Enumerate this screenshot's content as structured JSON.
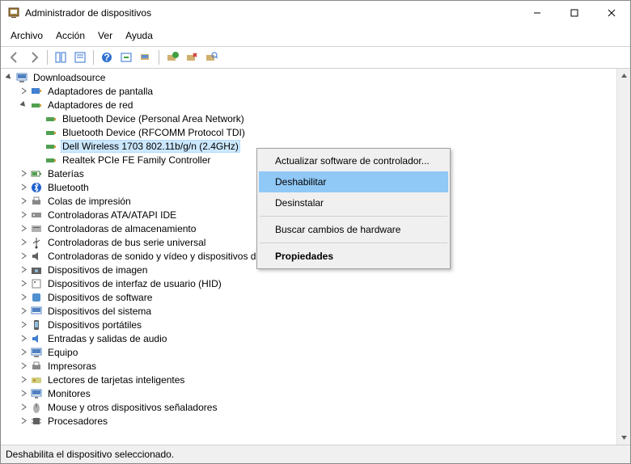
{
  "title": "Administrador de dispositivos",
  "menu": {
    "file": "Archivo",
    "action": "Acción",
    "view": "Ver",
    "help": "Ayuda"
  },
  "root": "Downloadsource",
  "tree": {
    "display_adapters": "Adaptadores de pantalla",
    "network_adapters": "Adaptadores de red",
    "net": {
      "bt_pan": "Bluetooth Device (Personal Area Network)",
      "bt_rfcomm": "Bluetooth Device (RFCOMM Protocol TDI)",
      "dell_wireless": "Dell Wireless 1703 802.11b/g/n (2.4GHz)",
      "realtek": "Realtek PCIe FE Family Controller"
    },
    "batteries": "Baterías",
    "bluetooth": "Bluetooth",
    "print_queues": "Colas de impresión",
    "ata": "Controladoras ATA/ATAPI IDE",
    "storage": "Controladoras de almacenamiento",
    "usb": "Controladoras de bus serie universal",
    "sound": "Controladoras de sonido y vídeo y dispositivos de juego",
    "imaging": "Dispositivos de imagen",
    "hid": "Dispositivos de interfaz de usuario (HID)",
    "software": "Dispositivos de software",
    "system": "Dispositivos del sistema",
    "portable": "Dispositivos portátiles",
    "audio_io": "Entradas y salidas de audio",
    "computer": "Equipo",
    "printers": "Impresoras",
    "smartcard": "Lectores de tarjetas inteligentes",
    "monitors": "Monitores",
    "mouse": "Mouse y otros dispositivos señaladores",
    "processors": "Procesadores"
  },
  "context_menu": {
    "update_driver": "Actualizar software de controlador...",
    "disable": "Deshabilitar",
    "uninstall": "Desinstalar",
    "scan_hw": "Buscar cambios de hardware",
    "properties": "Propiedades"
  },
  "status": "Deshabilita el dispositivo seleccionado."
}
